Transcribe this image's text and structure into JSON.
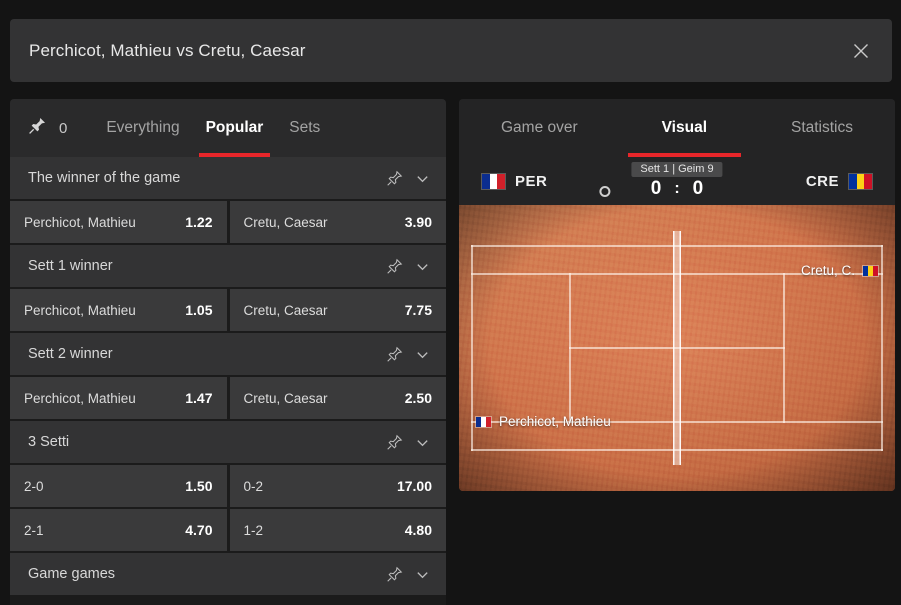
{
  "window": {
    "title": "Perchicot, Mathieu vs Cretu, Caesar",
    "close_icon": "close-icon"
  },
  "left_panel": {
    "pin": {
      "icon": "pushpin-filled-icon",
      "count": "0"
    },
    "tabs": [
      {
        "label": "Everything",
        "active": false
      },
      {
        "label": "Popular",
        "active": true
      },
      {
        "label": "Sets",
        "active": false
      }
    ],
    "markets": [
      {
        "title": "The winner of the game",
        "pin_icon": "pushpin-outline-icon",
        "chevron_icon": "chevron-down-icon",
        "selections": [
          [
            {
              "name": "Perchicot, Mathieu",
              "odds": "1.22"
            },
            {
              "name": "Cretu, Caesar",
              "odds": "3.90"
            }
          ]
        ]
      },
      {
        "title": "Sett 1 winner",
        "pin_icon": "pushpin-outline-icon",
        "chevron_icon": "chevron-down-icon",
        "selections": [
          [
            {
              "name": "Perchicot, Mathieu",
              "odds": "1.05"
            },
            {
              "name": "Cretu, Caesar",
              "odds": "7.75"
            }
          ]
        ]
      },
      {
        "title": "Sett 2 winner",
        "pin_icon": "pushpin-outline-icon",
        "chevron_icon": "chevron-down-icon",
        "selections": [
          [
            {
              "name": "Perchicot, Mathieu",
              "odds": "1.47"
            },
            {
              "name": "Cretu, Caesar",
              "odds": "2.50"
            }
          ]
        ]
      },
      {
        "title": "3 Setti",
        "pin_icon": "pushpin-outline-icon",
        "chevron_icon": "chevron-down-icon",
        "selections": [
          [
            {
              "name": "2-0",
              "odds": "1.50"
            },
            {
              "name": "0-2",
              "odds": "17.00"
            }
          ],
          [
            {
              "name": "2-1",
              "odds": "4.70"
            },
            {
              "name": "1-2",
              "odds": "4.80"
            }
          ]
        ]
      },
      {
        "title": "Game games",
        "pin_icon": "pushpin-outline-icon",
        "chevron_icon": "chevron-down-icon",
        "selections": []
      }
    ]
  },
  "right_panel": {
    "tabs": [
      {
        "label": "Game over",
        "active": false
      },
      {
        "label": "Visual",
        "active": true
      },
      {
        "label": "Statistics",
        "active": false
      }
    ],
    "scoreboard": {
      "home_abbr": "PER",
      "away_abbr": "CRE",
      "home_flag": "france-flag-icon",
      "away_flag": "romania-flag-icon",
      "period": "Sett 1 | Geim 9",
      "home_score": "0",
      "away_score": "0",
      "score_separator": ":",
      "serve_indicator": "serve-ball-icon",
      "serving": "home"
    },
    "court": {
      "surface": "clay",
      "surface_color": "#d4784e",
      "player_bottom_left": "Perchicot, Mathieu",
      "player_bottom_left_flag": "france-flag-icon",
      "player_top_right": "Cretu, C.",
      "player_top_right_flag": "romania-flag-icon"
    }
  },
  "colors": {
    "accent": "#e8262a",
    "panel": "#333334",
    "background": "#141414",
    "odds_button": "#3a3a3b"
  }
}
